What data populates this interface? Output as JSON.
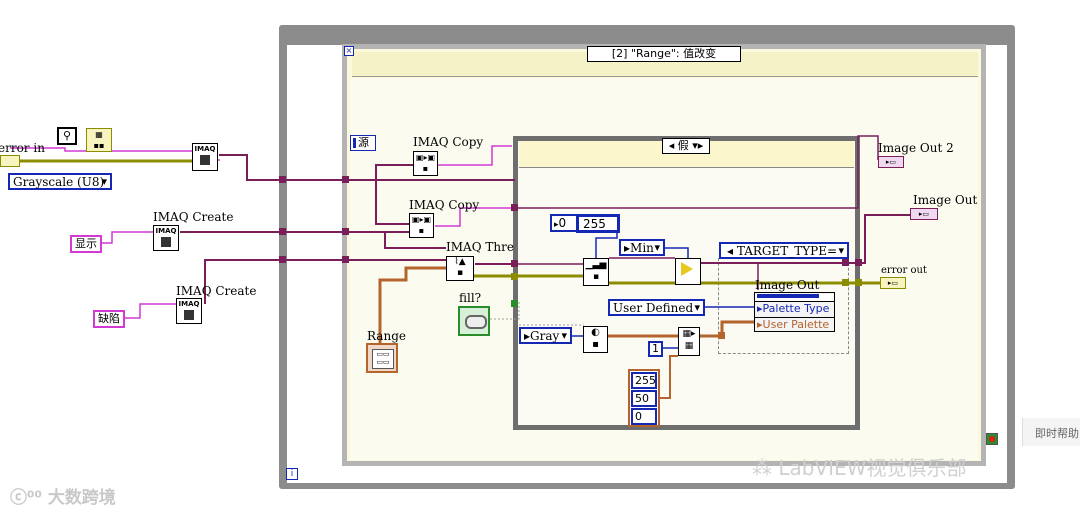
{
  "diagram": {
    "outer_case_selector": "[2] \"Range\": 值改变",
    "outer_case_number_icon": "[2]",
    "inner_case_selector": "假",
    "source_label": "源",
    "iteration_terminal": "i"
  },
  "controls": {
    "error_in": "error in",
    "grayscale_ring": "Grayscale (U8)",
    "display_name": "显示",
    "defect_name": "缺陷",
    "range_label": "Range",
    "fill_label": "fill?",
    "const_0": "0",
    "const_255": "255",
    "min_ring": "Min",
    "target_type_ring": "TARGET_TYPE=",
    "user_defined_ring": "User Defined",
    "gray_ring": "Gray",
    "const_1": "1",
    "array_values": [
      "255",
      "50",
      "0"
    ]
  },
  "nodes": {
    "imaq_top": "IMAQ",
    "imaq_create_1": "IMAQ Create",
    "imaq_create_2": "IMAQ Create",
    "imaq_copy_1": "IMAQ Copy",
    "imaq_copy_2": "IMAQ Copy",
    "imaq_threshold": "IMAQ Thre",
    "imaq_icon_text": "IMAQ"
  },
  "property_node": {
    "title": "Image Out",
    "rows": [
      "Palette Type",
      "User Palette"
    ]
  },
  "outputs": {
    "image_out_2": "Image Out 2",
    "image_out": "Image Out",
    "error_out": "error out"
  },
  "watermarks": {
    "bottom_left": "大数跨境",
    "bottom_right": "LabVIEW视觉俱乐部",
    "right_edge": "即时帮助"
  },
  "colors": {
    "image_wire": "#7a1e5a",
    "error_wire": "#8c8c00",
    "numeric_wire": "#1428b4",
    "array_wire": "#b4642d",
    "string_wire": "#d23ad2",
    "case_fill": "#fbf8dc",
    "window_gray": "#8c8c8c"
  }
}
